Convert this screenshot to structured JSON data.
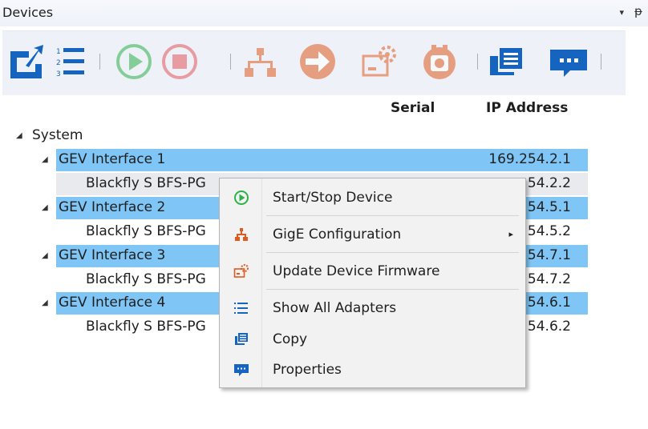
{
  "window": {
    "title": "Devices",
    "menu_glyph": "▾",
    "pin_glyph": "ᵽ"
  },
  "toolbar": {
    "buttons": [
      {
        "name": "refresh-icon",
        "enabled": true
      },
      {
        "name": "list-icon",
        "enabled": true
      },
      {
        "name": "play-icon",
        "enabled": false
      },
      {
        "name": "stop-icon",
        "enabled": false
      },
      {
        "name": "network-icon",
        "enabled": false
      },
      {
        "name": "forward-icon",
        "enabled": false
      },
      {
        "name": "gear-card-icon",
        "enabled": false
      },
      {
        "name": "camera-icon",
        "enabled": false
      },
      {
        "name": "copy-icon",
        "enabled": true
      },
      {
        "name": "chat-icon",
        "enabled": true
      }
    ]
  },
  "columns": {
    "serial": "Serial",
    "ip": "IP Address"
  },
  "tree": {
    "root": "System",
    "interfaces": [
      {
        "label": "GEV Interface 1",
        "ip": "169.254.2.1",
        "device": "Blackfly S BFS-PG",
        "device_ip": "54.2.2"
      },
      {
        "label": "GEV Interface 2",
        "ip": "54.5.1",
        "device": "Blackfly S BFS-PG",
        "device_ip": "54.5.2"
      },
      {
        "label": "GEV Interface 3",
        "ip": "54.7.1",
        "device": "Blackfly S BFS-PG",
        "device_ip": "54.7.2"
      },
      {
        "label": "GEV Interface 4",
        "ip": "54.6.1",
        "device": "Blackfly S BFS-PG",
        "device_ip": "54.6.2"
      }
    ]
  },
  "context_menu": {
    "items": [
      {
        "label": "Start/Stop Device",
        "icon": "play-icon"
      },
      {
        "label": "GigE Configuration",
        "icon": "network-icon",
        "submenu_arrow": "▸"
      },
      {
        "label": "Update Device Firmware",
        "icon": "firmware-icon"
      },
      {
        "label": "Show All Adapters",
        "icon": "list-icon"
      },
      {
        "label": "Copy",
        "icon": "copy-icon"
      },
      {
        "label": "Properties",
        "icon": "chat-icon"
      }
    ]
  },
  "colors": {
    "accent": "#1565c0",
    "selection": "#7fc6f6",
    "play": "#2db24a",
    "stop": "#e0565b",
    "network": "#e05a1f"
  }
}
